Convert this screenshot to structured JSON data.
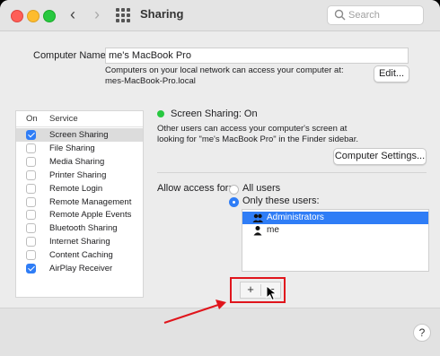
{
  "window": {
    "title": "Sharing",
    "search_placeholder": "Search",
    "nav_back": "‹",
    "nav_forward": "›"
  },
  "computer_name": {
    "label": "Computer Name:",
    "value": "me's MacBook Pro",
    "info_line1": "Computers on your local network can access your computer at:",
    "info_line2": "mes-MacBook-Pro.local",
    "edit_button": "Edit..."
  },
  "services": {
    "header_on": "On",
    "header_service": "Service",
    "items": [
      {
        "name": "Screen Sharing",
        "checked": true,
        "selected": true
      },
      {
        "name": "File Sharing",
        "checked": false,
        "selected": false
      },
      {
        "name": "Media Sharing",
        "checked": false,
        "selected": false
      },
      {
        "name": "Printer Sharing",
        "checked": false,
        "selected": false
      },
      {
        "name": "Remote Login",
        "checked": false,
        "selected": false
      },
      {
        "name": "Remote Management",
        "checked": false,
        "selected": false
      },
      {
        "name": "Remote Apple Events",
        "checked": false,
        "selected": false
      },
      {
        "name": "Bluetooth Sharing",
        "checked": false,
        "selected": false
      },
      {
        "name": "Internet Sharing",
        "checked": false,
        "selected": false
      },
      {
        "name": "Content Caching",
        "checked": false,
        "selected": false
      },
      {
        "name": "AirPlay Receiver",
        "checked": true,
        "selected": false
      }
    ]
  },
  "detail": {
    "status": "Screen Sharing: On",
    "status_color": "#28c840",
    "desc_line1": "Other users can access your computer's screen at",
    "desc_line2": "looking for \"me's MacBook Pro\" in the Finder sidebar.",
    "settings_button": "Computer Settings...",
    "allow_label": "Allow access for:",
    "radio_all": "All users",
    "radio_only": "Only these users:",
    "radio_selected": "Only these users:",
    "users": [
      {
        "name": "Administrators",
        "selected": true,
        "icon": "group-icon"
      },
      {
        "name": "me",
        "selected": false,
        "icon": "user-icon"
      }
    ],
    "add_symbol": "+",
    "remove_symbol": "−"
  },
  "help_symbol": "?",
  "annotation_color": "#e0151c"
}
